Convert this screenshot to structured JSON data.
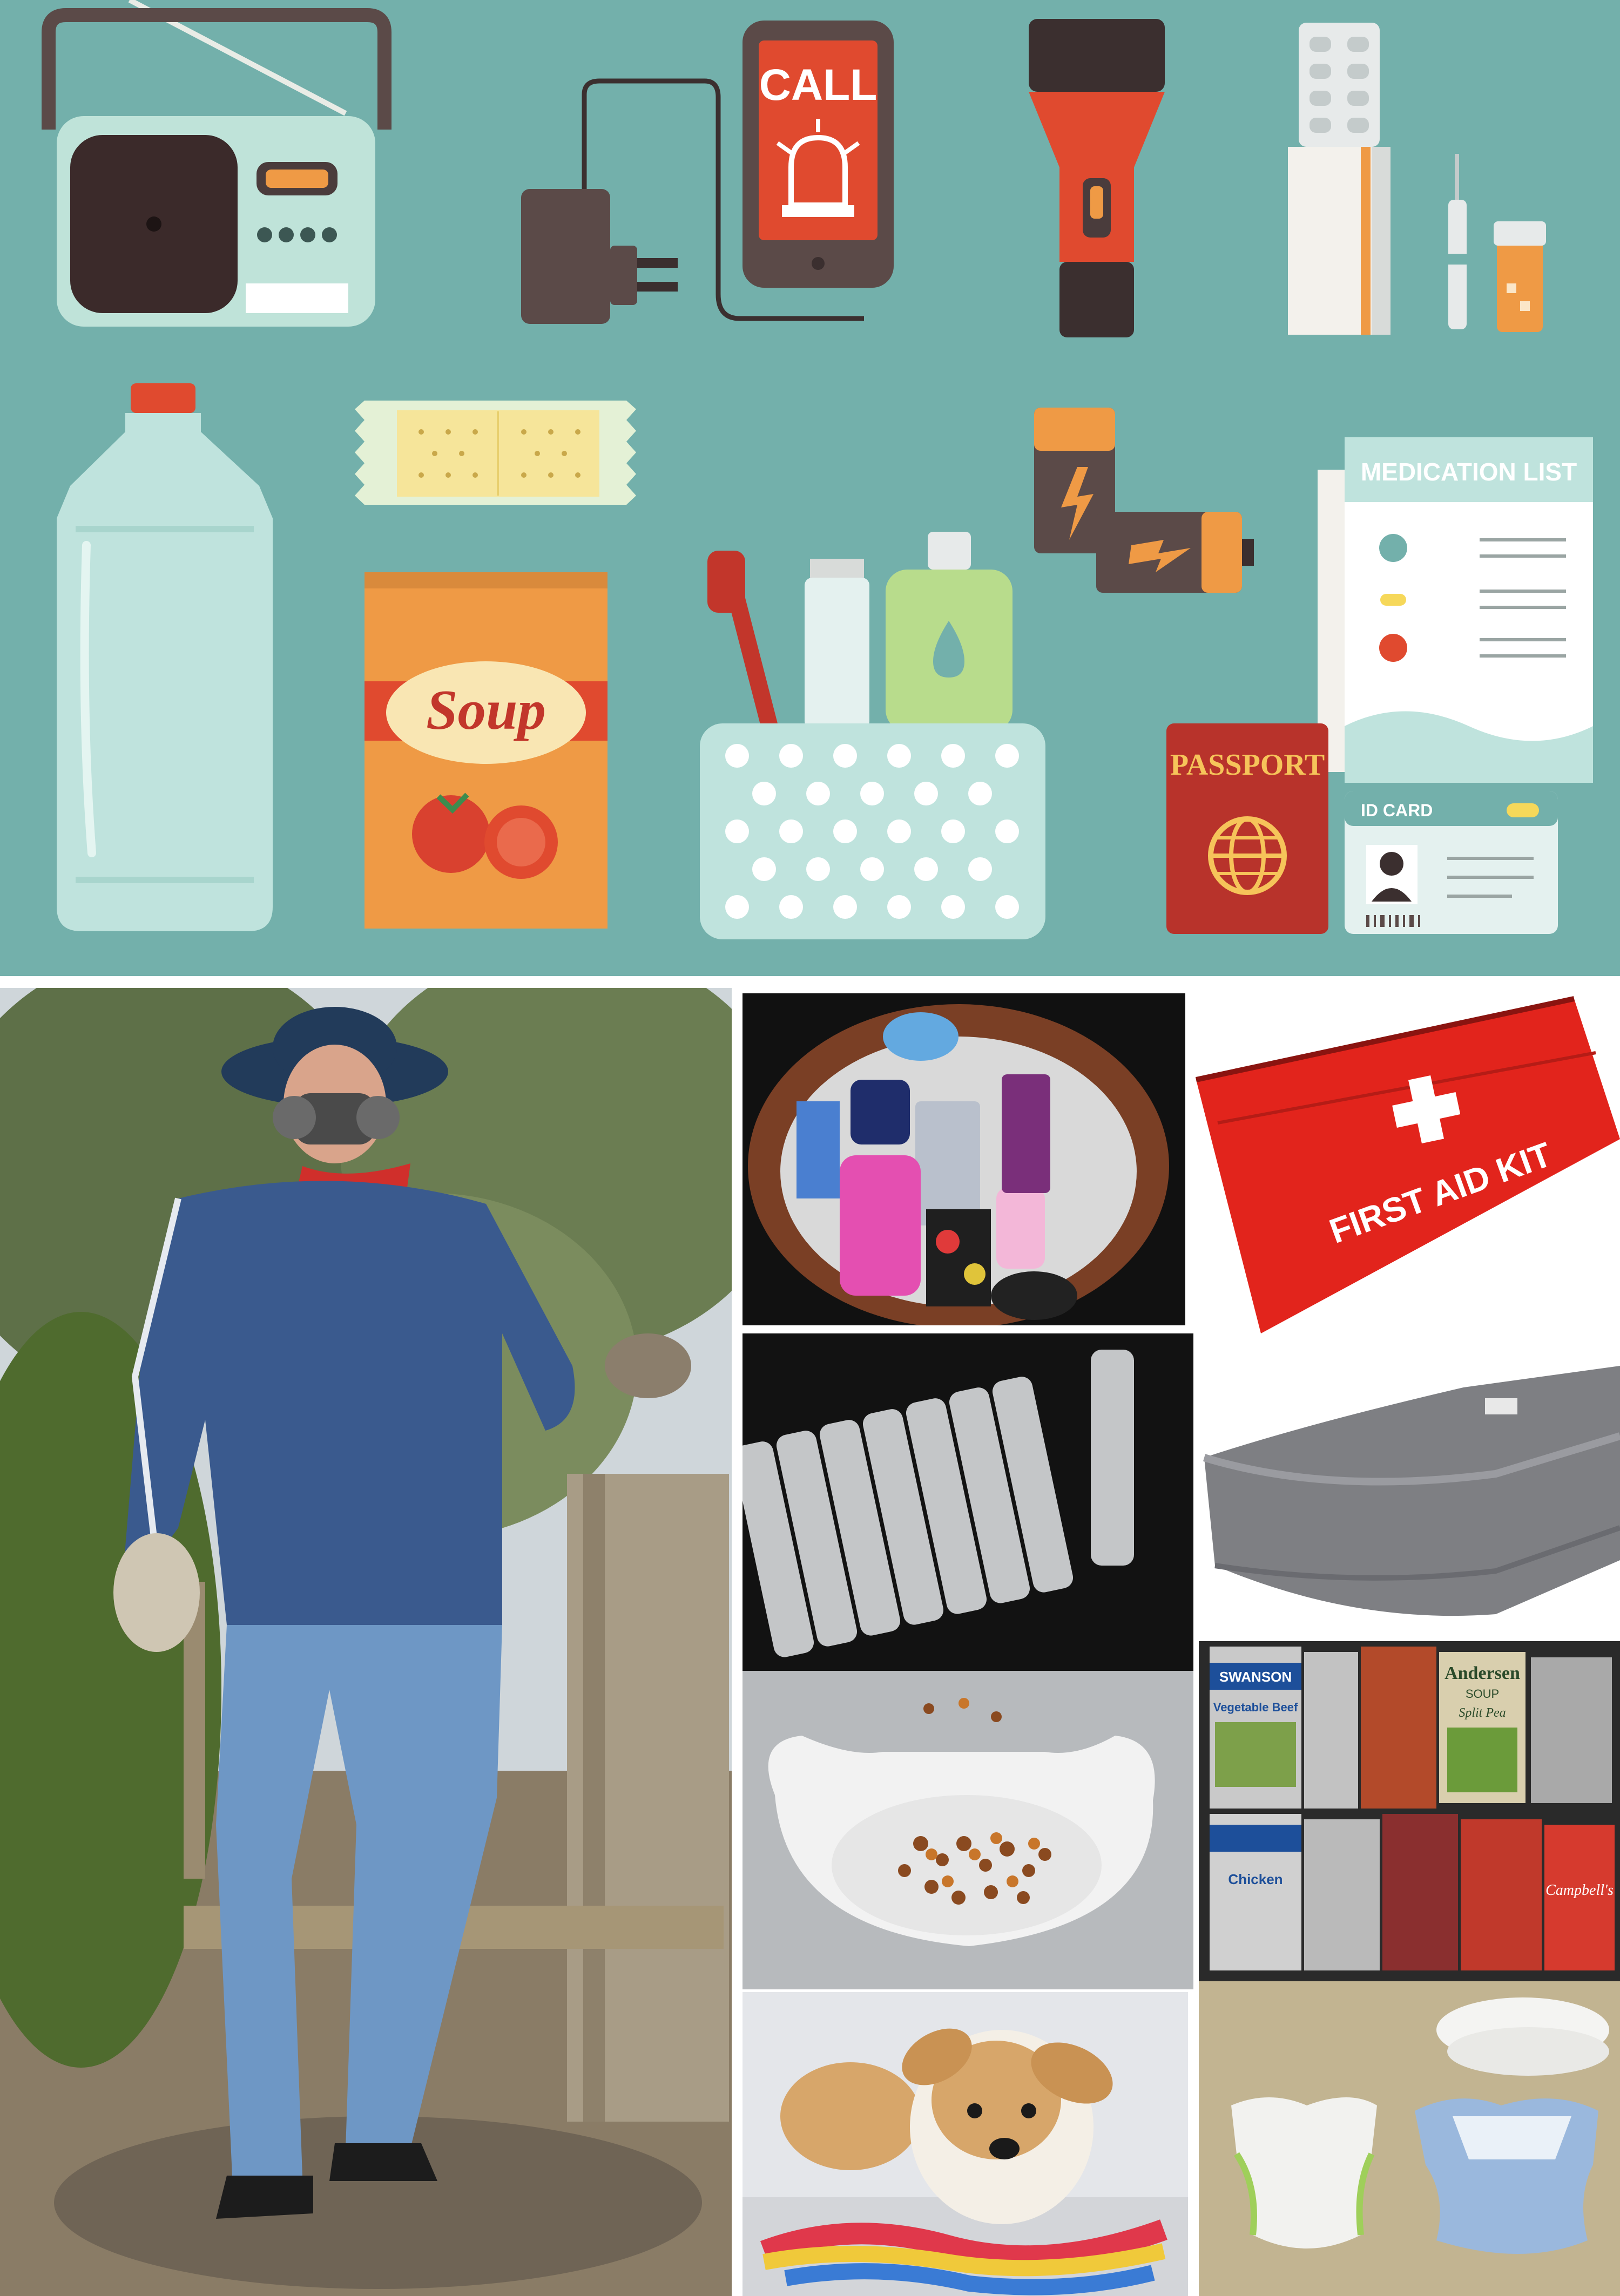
{
  "illustration": {
    "phone_label": "CALL",
    "soup_label": "Soup",
    "medication_list_title": "MEDICATION LIST",
    "passport_label": "PASSPORT",
    "id_card_label": "ID CARD"
  },
  "photos": {
    "first_aid_kit_label": "FIRST AID KIT",
    "can_brand_1": "SWANSON",
    "can_label_1": "Vegetable Beef",
    "can_label_2": "Chicken",
    "can_brand_2": "Andersen",
    "can_label_3": "SOUP",
    "can_label_4": "Split Pea",
    "can_brand_3": "Campbell's"
  },
  "colors": {
    "panel_teal": "#73b0ab",
    "shadow_teal": "#5f9893",
    "accent_red": "#e04a2f",
    "accent_orange": "#ef9a45"
  }
}
